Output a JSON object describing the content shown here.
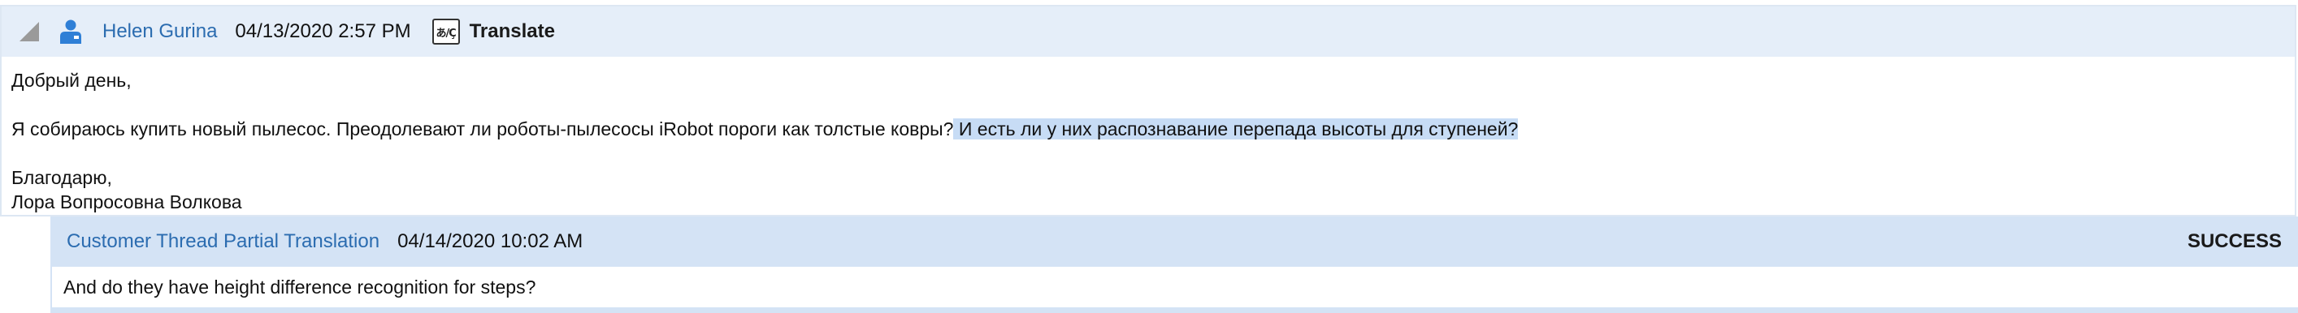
{
  "message": {
    "author": "Helen Gurina",
    "timestamp": "04/13/2020 2:57 PM",
    "translate_label": "Translate",
    "translate_icon_glyph": "あ/Ç",
    "greeting": "Добрый день,",
    "question_plain": "Я собираюсь купить новый пылесос. Преодолевают ли роботы-пылесосы iRobot пороги как толстые ковры?",
    "question_highlighted": " И есть ли у них распознавание перепада высоты для ступеней?",
    "thanks": "Благодарю,",
    "signature": "Лора Вопросовна Волкова"
  },
  "translation": {
    "title": "Customer Thread Partial Translation",
    "timestamp": "04/14/2020 10:02 AM",
    "status": "SUCCESS",
    "text": "And do they have height difference recognition for steps?"
  },
  "colors": {
    "link": "#2b6cb0",
    "header_bg": "#e5eef9",
    "translation_header_bg": "#d4e3f5",
    "highlight": "#c7dcf5"
  },
  "icons": {
    "collapse": "collapse-triangle-icon",
    "user": "user-person-icon",
    "translate": "translate-icon"
  }
}
